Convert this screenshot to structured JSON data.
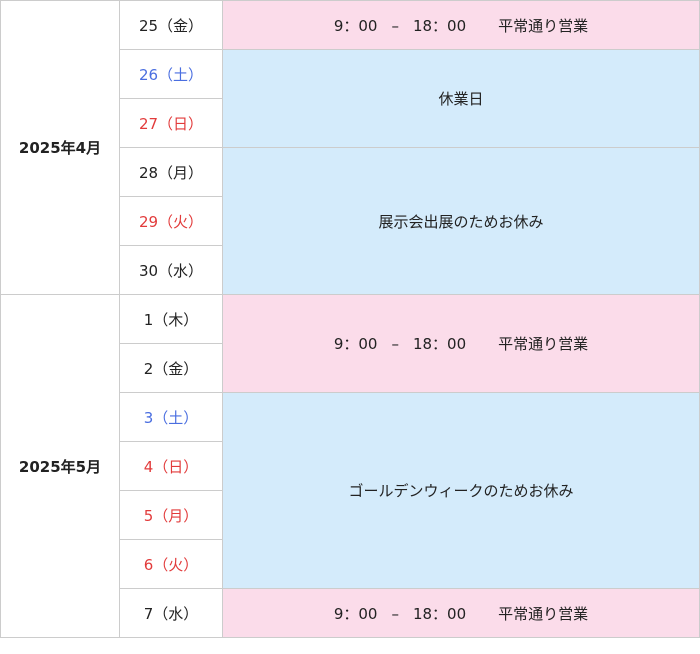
{
  "months": [
    {
      "label": "2025年4月",
      "days": [
        {
          "label": "25（金）",
          "type": "weekday"
        },
        {
          "label": "26（土）",
          "type": "sat"
        },
        {
          "label": "27（日）",
          "type": "sun"
        },
        {
          "label": "28（月）",
          "type": "weekday"
        },
        {
          "label": "29（火）",
          "type": "sun"
        },
        {
          "label": "30（水）",
          "type": "weekday"
        }
      ]
    },
    {
      "label": "2025年5月",
      "days": [
        {
          "label": "1（木）",
          "type": "weekday"
        },
        {
          "label": "2（金）",
          "type": "weekday"
        },
        {
          "label": "3（土）",
          "type": "sat"
        },
        {
          "label": "4（日）",
          "type": "sun"
        },
        {
          "label": "5（月）",
          "type": "sun"
        },
        {
          "label": "6（火）",
          "type": "sun"
        },
        {
          "label": "7（水）",
          "type": "weekday"
        }
      ]
    }
  ],
  "statuses": [
    {
      "kind": "open",
      "start": "9：00",
      "sep": "–",
      "end": "18：00",
      "label": "平常通り営業"
    },
    {
      "kind": "closed",
      "label": "休業日"
    },
    {
      "kind": "closed",
      "label": "展示会出展のためお休み"
    },
    {
      "kind": "open",
      "start": "9：00",
      "sep": "–",
      "end": "18：00",
      "label": "平常通り営業"
    },
    {
      "kind": "closed",
      "label": "ゴールデンウィークのためお休み"
    },
    {
      "kind": "open",
      "start": "9：00",
      "sep": "–",
      "end": "18：00",
      "label": "平常通り営業"
    }
  ],
  "colors": {
    "open_bg": "#fbdcea",
    "closed_bg": "#d4ebfb",
    "saturday": "#4a6ee0",
    "holiday": "#e23b3b",
    "border": "#cccccc"
  }
}
